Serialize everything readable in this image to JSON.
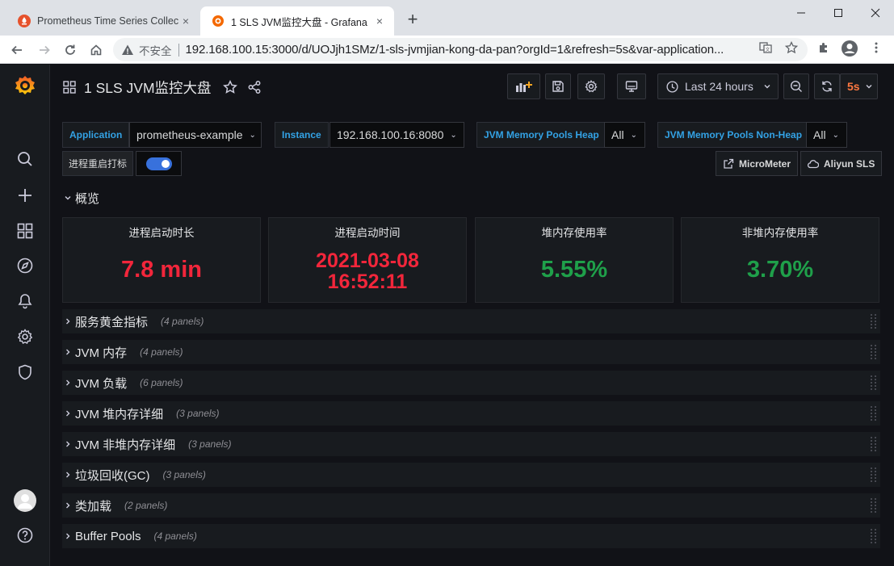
{
  "browser": {
    "tabs": [
      {
        "title": "Prometheus Time Series Collec",
        "close": "×"
      },
      {
        "title": "1 SLS JVM监控大盘 - Grafana",
        "close": "×"
      }
    ],
    "new_tab": "+",
    "insecure_label": "不安全",
    "url": "192.168.100.15:3000/d/UOJjh1SMz/1-sls-jvmjian-kong-da-pan?orgId=1&refresh=5s&var-application..."
  },
  "dashboard": {
    "title": "1 SLS JVM监控大盘",
    "time_range": "Last 24 hours",
    "refresh": "5s",
    "refresh_color": "#ff7941"
  },
  "variables": {
    "application": {
      "label": "Application",
      "value": "prometheus-example"
    },
    "instance": {
      "label": "Instance",
      "value": "192.168.100.16:8080"
    },
    "heap": {
      "label": "JVM Memory Pools Heap",
      "value": "All"
    },
    "nonheap": {
      "label": "JVM Memory Pools Non-Heap",
      "value": "All"
    },
    "restart_marker": {
      "label": "进程重启打标",
      "enabled": true
    }
  },
  "links": {
    "micrometer": "MicroMeter",
    "aliyun": "Aliyun SLS"
  },
  "overview_row": {
    "title": "概览"
  },
  "stats": [
    {
      "title": "进程启动时长",
      "value": "7.8 min",
      "color": "#f2263b"
    },
    {
      "title": "进程启动时间",
      "value_line1": "2021-03-08",
      "value_line2": "16:52:11",
      "color": "#f2263b"
    },
    {
      "title": "堆内存使用率",
      "value": "5.55%",
      "color": "#1fa04a"
    },
    {
      "title": "非堆内存使用率",
      "value": "3.70%",
      "color": "#1fa04a"
    }
  ],
  "rows": [
    {
      "title": "服务黄金指标",
      "count": "(4 panels)"
    },
    {
      "title": "JVM 内存",
      "count": "(4 panels)"
    },
    {
      "title": "JVM 负载",
      "count": "(6 panels)"
    },
    {
      "title": "JVM 堆内存详细",
      "count": "(3 panels)"
    },
    {
      "title": "JVM 非堆内存详细",
      "count": "(3 panels)"
    },
    {
      "title": "垃圾回收(GC)",
      "count": "(3 panels)"
    },
    {
      "title": "类加载",
      "count": "(2 panels)"
    },
    {
      "title": "Buffer Pools",
      "count": "(4 panels)"
    }
  ],
  "icons": {
    "sidebar": [
      "grafana-logo-icon",
      "search-icon",
      "plus-icon",
      "dashboards-icon",
      "explore-icon",
      "alerting-icon",
      "settings-icon",
      "shield-icon",
      "user-avatar-icon",
      "help-icon"
    ]
  }
}
